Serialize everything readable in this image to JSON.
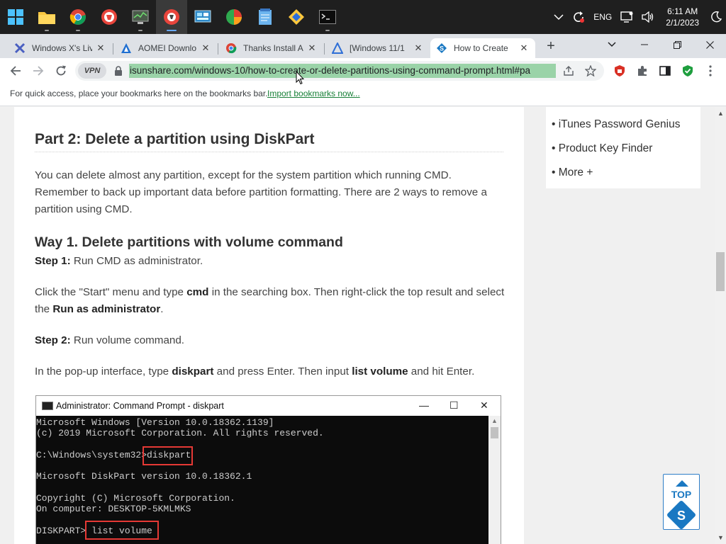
{
  "taskbar": {
    "apps": [
      {
        "name": "start-icon"
      },
      {
        "name": "file-explorer-icon"
      },
      {
        "name": "chrome-icon"
      },
      {
        "name": "shield-browser-icon"
      },
      {
        "name": "system-monitor-icon"
      },
      {
        "name": "active-browser-icon"
      },
      {
        "name": "control-panel-icon"
      },
      {
        "name": "color-tool-icon"
      },
      {
        "name": "notepad-icon"
      },
      {
        "name": "media-tool-icon"
      },
      {
        "name": "terminal-icon"
      }
    ],
    "language": "ENG",
    "time": "6:11 AM",
    "date": "2/1/2023"
  },
  "tabs": [
    {
      "title": "Windows X's Liv",
      "favicon": "windows-x-favicon"
    },
    {
      "title": "AOMEI Downlo",
      "favicon": "aomei-favicon"
    },
    {
      "title": "Thanks Install A",
      "favicon": "chrome-favicon"
    },
    {
      "title": "[Windows 11/1",
      "favicon": "partition-favicon"
    },
    {
      "title": "How to Create",
      "favicon": "isunshare-favicon",
      "active": true
    }
  ],
  "toolbar": {
    "vpn_label": "VPN",
    "url": "isunshare.com/windows-10/how-to-create-or-delete-partitions-using-command-prompt.html#pa"
  },
  "bookmarks_bar": {
    "prompt": "For quick access, place your bookmarks here on the bookmarks bar.",
    "import_link": "Import bookmarks now..."
  },
  "sidebar": {
    "items": [
      "• iTunes Password Genius",
      "• Product Key Finder",
      "• More +"
    ]
  },
  "article": {
    "part_heading": "Part 2: Delete a partition using DiskPart",
    "intro": "You can delete almost any partition, except for the system partition which running CMD. Remember to back up important data before partition formatting. There are 2 ways to remove a partition using CMD.",
    "way1_heading": "Way 1. Delete partitions with volume command",
    "step1_label": "Step 1:",
    "step1_text": " Run CMD as administrator.",
    "click_pre": "Click the \"Start\" menu and type ",
    "click_cmd": "cmd",
    "click_mid": " in the searching box. Then right-click the top result and select the ",
    "click_run": "Run as administrator",
    "click_end": ".",
    "step2_label": "Step 2:",
    "step2_text": " Run volume command.",
    "popup_pre": "In the pop-up interface, type ",
    "popup_diskpart": "diskpart",
    "popup_mid": " and press Enter. Then input ",
    "popup_list": "list volume",
    "popup_end": " and hit Enter."
  },
  "cmd_window": {
    "title": "Administrator: Command Prompt - diskpart",
    "lines": [
      "Microsoft Windows [Version 10.0.18362.1139]",
      "(c) 2019 Microsoft Corporation. All rights reserved.",
      "",
      "C:\\Windows\\system32>diskpart",
      "",
      "Microsoft DiskPart version 10.0.18362.1",
      "",
      "Copyright (C) Microsoft Corporation.",
      "On computer: DESKTOP-5KMLMKS",
      "",
      "DISKPART> list volume"
    ]
  },
  "top_button": {
    "label": "TOP",
    "logo": "S"
  },
  "colors": {
    "taskbar": "#1f1f1f",
    "tabstrip": "#dee1e6",
    "url_highlight": "#9ad3a8",
    "link": "#1a73e8",
    "accent_blue": "#1a78c2",
    "cmd_highlight": "#e53935"
  }
}
